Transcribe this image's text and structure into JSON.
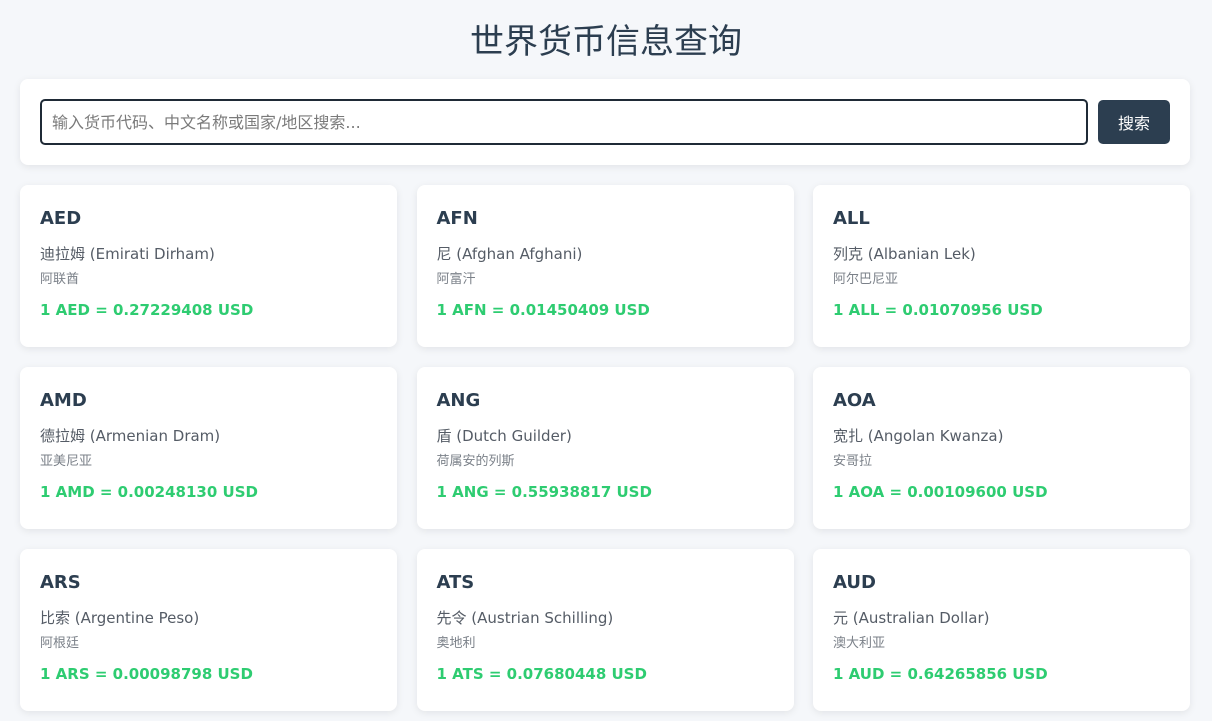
{
  "page": {
    "title": "世界货币信息查询"
  },
  "search": {
    "placeholder": "输入货币代码、中文名称或国家/地区搜索...",
    "value": "",
    "button_label": "搜索"
  },
  "colors": {
    "primary": "#2c3e50",
    "rate_green": "#2ecc71",
    "background": "#f5f7fa"
  },
  "currencies": [
    {
      "code": "AED",
      "name": "迪拉姆 (Emirati Dirham)",
      "country": "阿联酋",
      "rate": "1 AED = 0.27229408 USD"
    },
    {
      "code": "AFN",
      "name": "尼 (Afghan Afghani)",
      "country": "阿富汗",
      "rate": "1 AFN = 0.01450409 USD"
    },
    {
      "code": "ALL",
      "name": "列克 (Albanian Lek)",
      "country": "阿尔巴尼亚",
      "rate": "1 ALL = 0.01070956 USD"
    },
    {
      "code": "AMD",
      "name": "德拉姆 (Armenian Dram)",
      "country": "亚美尼亚",
      "rate": "1 AMD = 0.00248130 USD"
    },
    {
      "code": "ANG",
      "name": "盾 (Dutch Guilder)",
      "country": "荷属安的列斯",
      "rate": "1 ANG = 0.55938817 USD"
    },
    {
      "code": "AOA",
      "name": "宽扎 (Angolan Kwanza)",
      "country": "安哥拉",
      "rate": "1 AOA = 0.00109600 USD"
    },
    {
      "code": "ARS",
      "name": "比索 (Argentine Peso)",
      "country": "阿根廷",
      "rate": "1 ARS = 0.00098798 USD"
    },
    {
      "code": "ATS",
      "name": "先令 (Austrian Schilling)",
      "country": "奥地利",
      "rate": "1 ATS = 0.07680448 USD"
    },
    {
      "code": "AUD",
      "name": "元 (Australian Dollar)",
      "country": "澳大利亚",
      "rate": "1 AUD = 0.64265856 USD"
    }
  ]
}
